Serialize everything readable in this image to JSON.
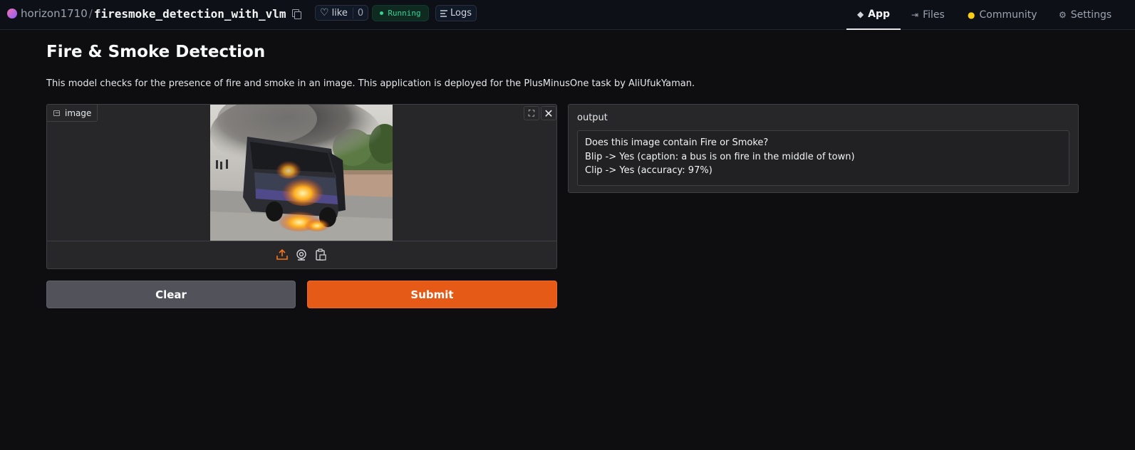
{
  "header": {
    "owner": "horizon1710",
    "separator": "/",
    "repo_name": "firesmoke_detection_with_vlm",
    "like_label": "like",
    "like_count": "0",
    "status": "Running",
    "logs_label": "Logs",
    "nav": {
      "app": "App",
      "files": "Files",
      "community": "Community",
      "settings": "Settings"
    }
  },
  "main": {
    "title": "Fire & Smoke Detection",
    "description": "This model checks for the presence of fire and smoke in an image. This application is deployed for the PlusMinusOne task by AliUfukYaman.",
    "image_input": {
      "label": "image",
      "icons": [
        "upload-icon",
        "webcam-icon",
        "clipboard-icon",
        "fullscreen-icon",
        "close-icon"
      ]
    },
    "buttons": {
      "clear": "Clear",
      "submit": "Submit"
    },
    "output": {
      "label": "output",
      "lines": [
        "Does this image contain Fire or Smoke?",
        "Blip -> Yes (caption: a bus is on fire in the middle of town)",
        "Clip -> Yes (accuracy: 97%)"
      ]
    }
  },
  "colors": {
    "background": "#0e0e11",
    "panel": "#27272a",
    "accent": "#e55a17",
    "secondary_button": "#52525b",
    "running": "#34d399"
  }
}
